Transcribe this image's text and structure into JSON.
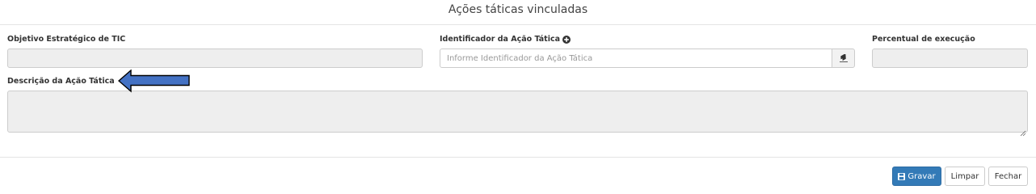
{
  "modal": {
    "title": "Ações táticas vinculadas"
  },
  "form": {
    "objetivo_label": "Objetivo Estratégico de TIC",
    "objetivo_value": "",
    "identificador_label": "Identificador da Ação Tática",
    "identificador_placeholder": "Informe Identificador da Ação Tática",
    "identificador_value": "",
    "percentual_label": "Percentual de execução",
    "percentual_value": "",
    "descricao_label": "Descrição da Ação Tática",
    "descricao_value": ""
  },
  "icons": {
    "add": "plus-circle-icon",
    "clear": "eraser-icon",
    "save": "floppy-disk-icon",
    "annotation": "arrow-left-icon"
  },
  "colors": {
    "primary": "#337ab7",
    "arrow_fill": "#4472c4",
    "arrow_stroke": "#000000",
    "readonly_bg": "#eeeeee"
  },
  "footer": {
    "save_label": "Gravar",
    "clear_label": "Limpar",
    "close_label": "Fechar"
  }
}
